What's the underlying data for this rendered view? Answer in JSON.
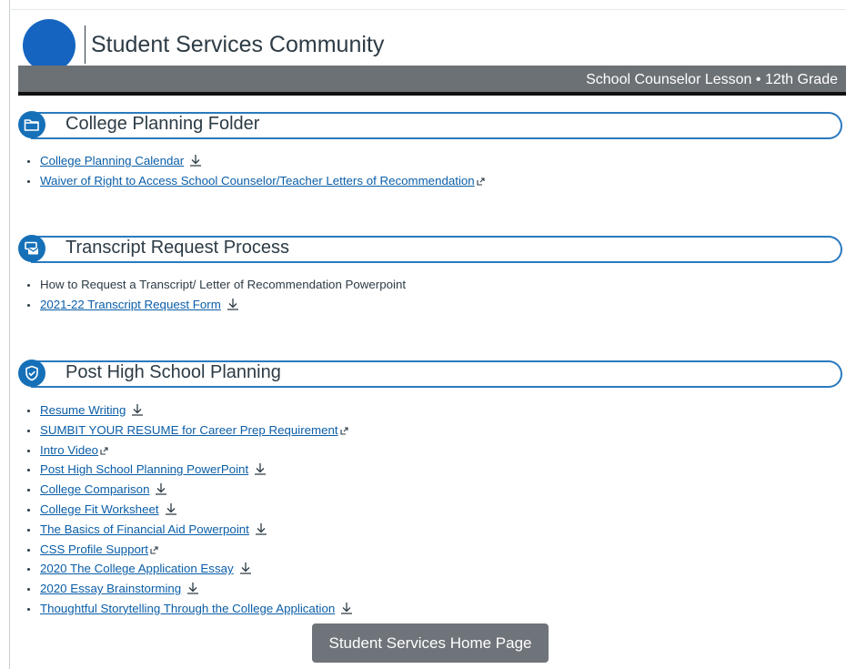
{
  "site": {
    "title": "Student Services Community",
    "banner": "School Counselor Lesson • 12th Grade"
  },
  "sections": [
    {
      "title": "College Planning Folder",
      "icon": "folder-icon",
      "items": [
        {
          "label": "College Planning Calendar",
          "link": true,
          "marker": "download-icon"
        },
        {
          "label": "Waiver of Right to Access School Counselor/Teacher Letters of Recommendation",
          "link": true,
          "marker": "external-link-icon"
        }
      ]
    },
    {
      "title": "Transcript Request Process",
      "icon": "mail-document-icon",
      "items": [
        {
          "label": "How to Request a Transcript/ Letter of Recommendation Powerpoint",
          "link": false,
          "marker": ""
        },
        {
          "label": "2021-22 Transcript Request Form",
          "link": true,
          "marker": "download-icon"
        }
      ]
    },
    {
      "title": "Post High School Planning",
      "icon": "shield-check-icon",
      "items": [
        {
          "label": "Resume Writing",
          "link": true,
          "marker": "download-icon"
        },
        {
          "label": "SUMBIT YOUR RESUME for Career Prep Requirement",
          "link": true,
          "marker": "external-link-icon"
        },
        {
          "label": "Intro Video",
          "link": true,
          "marker": "external-link-icon"
        },
        {
          "label": "Post High School Planning PowerPoint",
          "link": true,
          "marker": "download-icon"
        },
        {
          "label": "College Comparison",
          "link": true,
          "marker": "download-icon"
        },
        {
          "label": "College Fit Worksheet",
          "link": true,
          "marker": "download-icon"
        },
        {
          "label": "The Basics of Financial Aid Powerpoint",
          "link": true,
          "marker": "download-icon"
        },
        {
          "label": "CSS Profile Support",
          "link": true,
          "marker": "external-link-icon"
        },
        {
          "label": "2020 The College Application Essay",
          "link": true,
          "marker": "download-icon"
        },
        {
          "label": "2020 Essay Brainstorming",
          "link": true,
          "marker": "download-icon"
        },
        {
          "label": "Thoughtful Storytelling Through the College Application",
          "link": true,
          "marker": "download-icon"
        }
      ]
    }
  ],
  "home_button": {
    "label": "Student Services Home Page"
  },
  "colors": {
    "accent": "#1670b8",
    "link": "#0b5ea8",
    "banner": "#6c7176",
    "button": "#6f747a"
  }
}
